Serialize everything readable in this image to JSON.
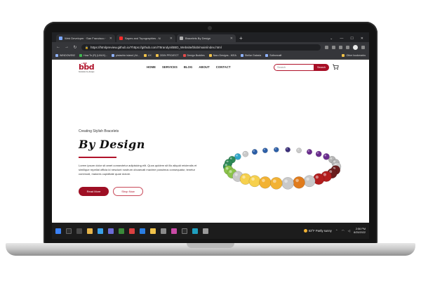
{
  "browser": {
    "tabs": [
      {
        "label": "Web Developer · San Francisco ·",
        "icon": "linkedin-icon"
      },
      {
        "label": "Sapes and Topographies - N",
        "icon": "youtube-icon"
      },
      {
        "label": "Bracelets By Design",
        "icon": "bbd-favicon"
      }
    ],
    "url": "https://htmlpreview.github.io/?https://github.com/T8randyn/BBD_Website/blob/main/index.html",
    "bookmarks": [
      "WINDOWS92",
      "How To (R) (UI/UX)...",
      "pistachio island | At...",
      "UX",
      "ODIN PROJECT",
      "Design Buddies",
      "Naru Designs - IKEA",
      "Stellar Galaxia",
      "Solbonnaft"
    ],
    "other_bookmarks": "Other bookmarks"
  },
  "site": {
    "logo": {
      "badge": "+ BBD",
      "text": "bbd",
      "sub": "bracelets by design"
    },
    "nav": [
      "HOME",
      "SERVICES",
      "BLOG",
      "ABOUT",
      "CONTACT"
    ],
    "search": {
      "placeholder": "Search",
      "button": "Search"
    },
    "hero": {
      "tagline": "Creating Stylish Bracelets",
      "title": "By Design",
      "body": "Lorem ipsum dolor sit amet consectetur adipisicing elit. Quos quidem sit illo aliquid reiciendis et similique repellat officia id nesciunt nostrum obcaecati maxime possimus consequatur, tenetur commodi, maiores cupiditate quae dolore.",
      "primary_button": "Read More",
      "secondary_button": "Shop Now"
    },
    "colors": {
      "accent": "#a80f26"
    }
  },
  "taskbar": {
    "weather": "63°F  Partly sunny",
    "time": "2:56 PM",
    "date": "8/25/2022"
  }
}
